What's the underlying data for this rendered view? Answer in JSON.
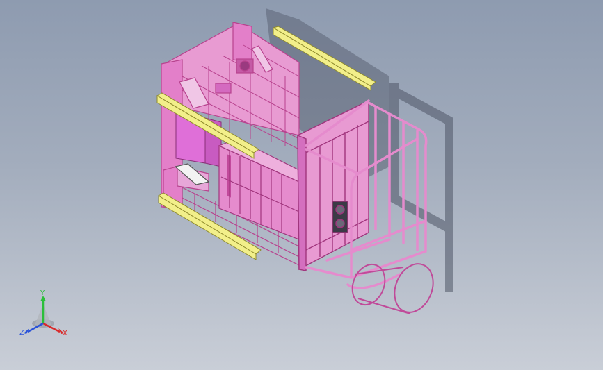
{
  "viewport": {
    "background_top": "#8e9bb0",
    "background_bottom": "#c9ced7",
    "model_color": "#e79ad0",
    "model_edge_color": "#b8428e",
    "rail_color": "#f2ef8a",
    "panel_color": "#d96fd0"
  },
  "triad": {
    "y_label": "Y",
    "z_label": "Z",
    "x_label": "X",
    "y_color": "#2bbf3a",
    "z_color": "#2952d9",
    "x_color": "#d82a2a"
  }
}
